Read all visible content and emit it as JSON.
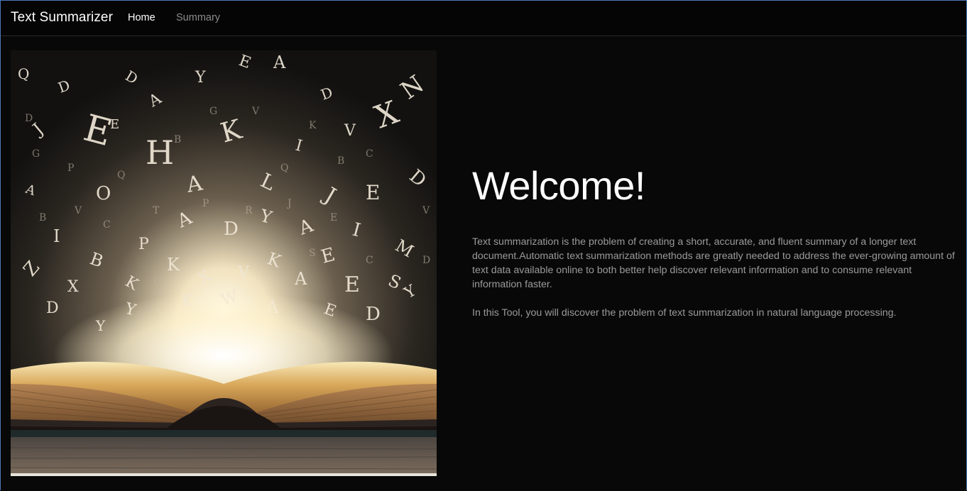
{
  "navbar": {
    "brand": "Text Summarizer",
    "links": [
      {
        "label": "Home",
        "active": true
      },
      {
        "label": "Summary",
        "active": false
      }
    ]
  },
  "hero": {
    "image_icon": "open-book-flying-letters-image"
  },
  "main": {
    "heading": "Welcome!",
    "paragraphs": [
      "Text summarization is the problem of creating a short, accurate, and fluent summary of a longer text document.Automatic text summarization methods are greatly needed to address the ever-growing amount of text data available online to both better help discover relevant information and to consume relevant information faster.",
      "In this Tool, you will discover the problem of text summarization in natural language processing."
    ]
  },
  "colors": {
    "background": "#080808",
    "navbar": "#050505",
    "text_primary": "#ffffff",
    "text_muted": "#9a9a9a",
    "window_border": "#4a78b8"
  }
}
